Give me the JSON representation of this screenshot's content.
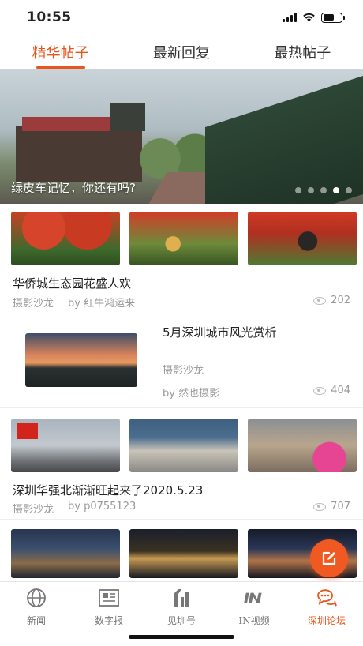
{
  "status": {
    "time": "10:55"
  },
  "tabs": [
    {
      "label": "精华帖子",
      "active": true
    },
    {
      "label": "最新回复",
      "active": false
    },
    {
      "label": "最热帖子",
      "active": false
    }
  ],
  "banner": {
    "caption": "绿皮车记忆，你还有吗?",
    "dots_total": 5,
    "active_dot": 4
  },
  "posts": [
    {
      "title": "华侨城生态园花盛人欢",
      "section": "摄影沙龙",
      "author": "by 红牛鸿运来",
      "views": "202"
    },
    {
      "title": "5月深圳城市风光赏析",
      "section": "摄影沙龙",
      "author": "by 然也摄影",
      "views": "404"
    },
    {
      "title": "深圳华强北渐渐旺起来了2020.5.23",
      "section": "摄影沙龙",
      "author": "by p0755123",
      "views": "707"
    }
  ],
  "tabbar": [
    {
      "label": "新闻",
      "icon": "globe-icon",
      "active": false
    },
    {
      "label": "数字报",
      "icon": "newspaper-icon",
      "active": false
    },
    {
      "label": "见圳号",
      "icon": "jianzhen-logo-icon",
      "active": false
    },
    {
      "label": "IN视频",
      "icon": "in-video-icon",
      "active": false
    },
    {
      "label": "深圳论坛",
      "icon": "chat-bubbles-icon",
      "active": true
    }
  ],
  "colors": {
    "accent": "#e8561e",
    "fab": "#f05a22"
  }
}
